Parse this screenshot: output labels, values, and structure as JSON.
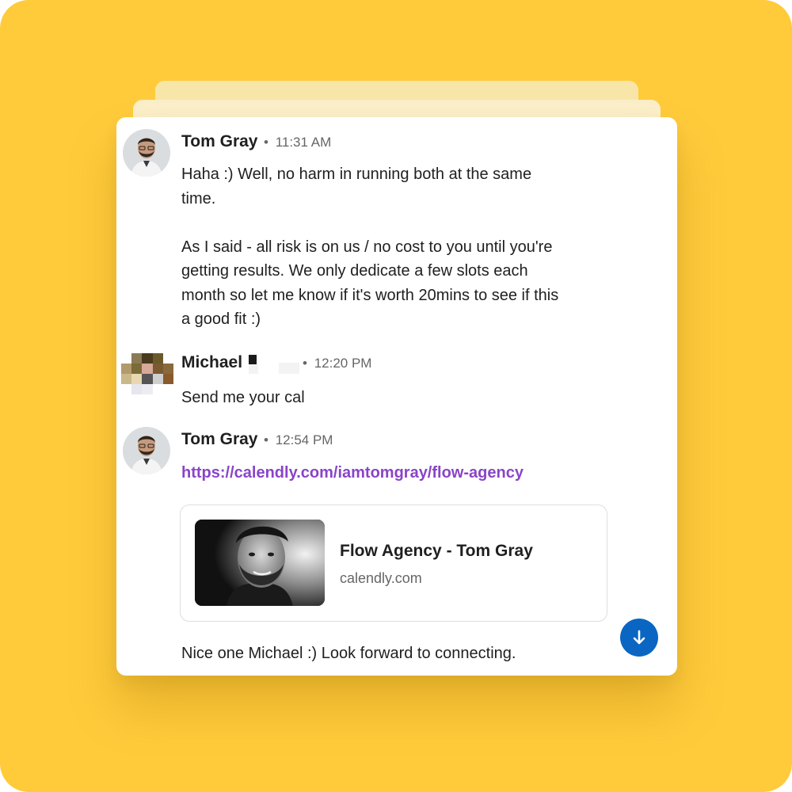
{
  "conversation": {
    "messages": [
      {
        "sender": "Tom Gray",
        "time": "11:31 AM",
        "text": "Haha :) Well, no harm in running both at the same\ntime.\n\nAs I said - all risk is on us / no cost to you until you're\ngetting results. We only dedicate a few slots each\nmonth so let me know if it's worth 20mins to see if this\na good fit :)"
      },
      {
        "sender": "Michael",
        "time": "12:20 PM",
        "text": "Send me your cal"
      },
      {
        "sender": "Tom Gray",
        "time": "12:54 PM",
        "link": "https://calendly.com/iamtomgray/flow-agency",
        "preview": {
          "title": "Flow Agency - Tom Gray",
          "domain": "calendly.com"
        },
        "text": "Nice one Michael :) Look forward to connecting."
      }
    ],
    "separator": "•"
  },
  "colors": {
    "background": "#FFCB3B",
    "link": "#8A44C8",
    "scroll_button": "#0A66C2"
  },
  "icons": {
    "scroll_button": "arrow-down-icon"
  }
}
